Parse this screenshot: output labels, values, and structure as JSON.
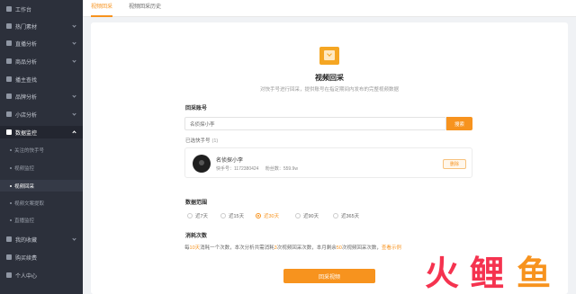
{
  "sidebar": {
    "items": [
      {
        "label": "工作台",
        "top": 0
      },
      {
        "label": "热门素材",
        "chev": true
      },
      {
        "label": "直播分析",
        "chev": true
      },
      {
        "label": "商品分析",
        "chev": true
      },
      {
        "label": "播主查找"
      },
      {
        "label": "品牌分析",
        "chev": true
      },
      {
        "label": "小店分析",
        "chev": true
      },
      {
        "label": "数据监控",
        "open": true
      }
    ],
    "sub_items": [
      {
        "label": "关注的快手号"
      },
      {
        "label": "视频监控"
      },
      {
        "label": "视频回采",
        "active": true
      },
      {
        "label": "视频文案提取"
      },
      {
        "label": "直播监控"
      }
    ],
    "bottom_items": [
      {
        "label": "我的收藏",
        "chev": true
      },
      {
        "label": "购买续费"
      },
      {
        "label": "个人中心"
      }
    ]
  },
  "tabs": [
    {
      "label": "视频回采",
      "active": true
    },
    {
      "label": "视频回采历史",
      "active": false
    }
  ],
  "hero": {
    "title": "视频回采",
    "subtitle": "对快手号进行回采，提供账号在指定期间内发布的完整视频数据"
  },
  "account_section": {
    "label": "回采账号",
    "search_value": "名侦探小李",
    "search_button": "搜索",
    "selected_label": "已选快手号",
    "selected_count": "(1)",
    "account": {
      "name": "名侦探小李",
      "id_text": "快手号：1172380424",
      "fans_text": "粉丝数：559.9w",
      "delete_label": "删除"
    }
  },
  "range_section": {
    "label": "数据范围",
    "options": [
      {
        "label": "近7天",
        "checked": false
      },
      {
        "label": "近15天",
        "checked": false
      },
      {
        "label": "近30天",
        "checked": true
      },
      {
        "label": "近90天",
        "checked": false
      },
      {
        "label": "近365天",
        "checked": false
      }
    ]
  },
  "usage_section": {
    "label": "消耗次数",
    "p1": "每",
    "p2": "10天",
    "p3": "消耗一个次数，本次分析共需消耗",
    "p4": "3",
    "p5": "次视频回采次数，本月剩余",
    "p6": "50",
    "p7": "次视频回采次数，",
    "link": "查看示例"
  },
  "submit_label": "回采视频",
  "watermark": {
    "chars": [
      "火",
      "鲤",
      "鱼"
    ]
  },
  "colors": {
    "accent": "#f7931e",
    "sidebar_bg": "#2c303b"
  }
}
